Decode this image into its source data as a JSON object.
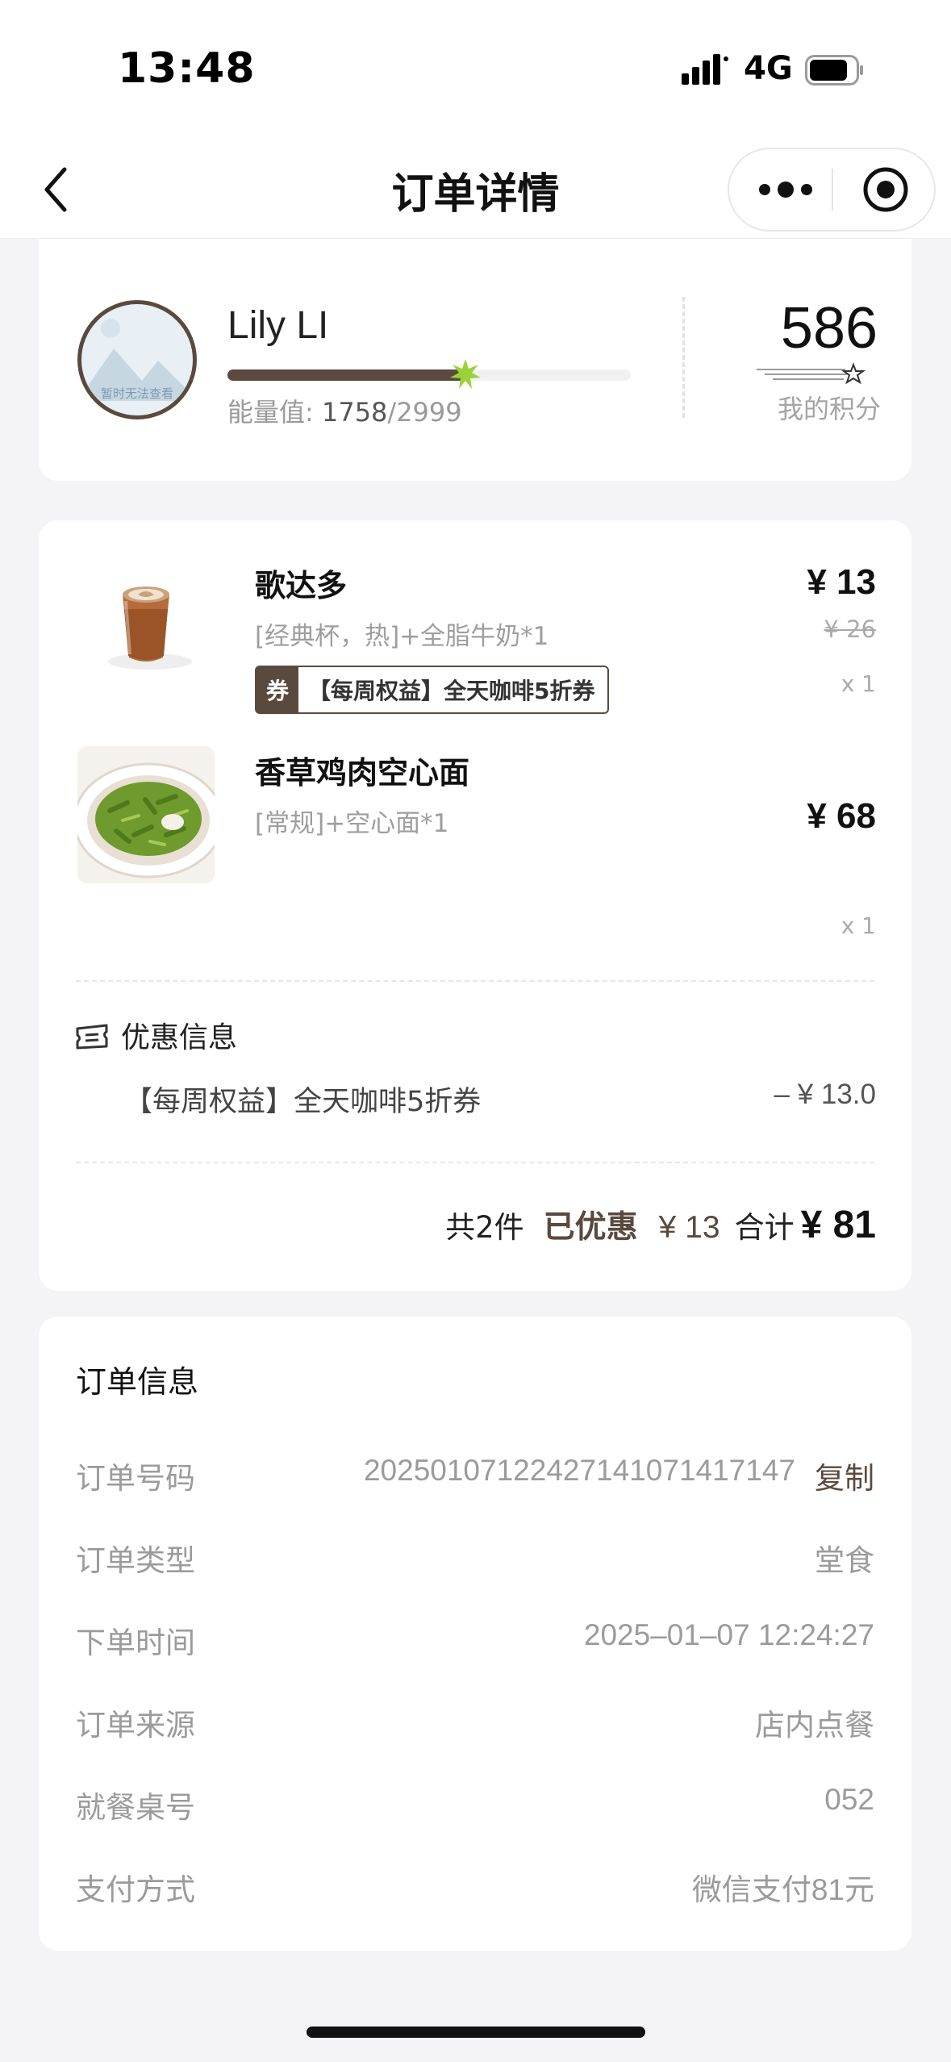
{
  "status_bar": {
    "time": "13:48",
    "network": "4G"
  },
  "nav": {
    "title": "订单详情"
  },
  "user": {
    "name": "Lily LI",
    "avatar_placeholder": "暂时无法查看",
    "energy_label": "能量值:",
    "energy_current": "1758",
    "energy_max": "/2999",
    "energy_progress": 0.59,
    "points": "586",
    "points_label": "我的积分"
  },
  "products": [
    {
      "name": "歌达多",
      "spec": "[经典杯，热]+全脂牛奶*1",
      "price": "¥ 13",
      "original_price": "¥ 26",
      "qty": "x 1",
      "coupon_tag": "券",
      "coupon_text": "【每周权益】全天咖啡5折券"
    },
    {
      "name": "香草鸡肉空心面",
      "spec": "[常规]+空心面*1",
      "price": "¥ 68",
      "qty": "x 1"
    }
  ],
  "discount": {
    "title": "优惠信息",
    "name": "【每周权益】全天咖啡5折券",
    "amount": "– ¥ 13.0"
  },
  "summary": {
    "count": "共2件",
    "discounted_label": "已优惠",
    "discounted_value": "¥ 13",
    "total_label": "合计",
    "total_value": "¥ 81"
  },
  "order_info": {
    "title": "订单信息",
    "copy_label": "复制",
    "rows": [
      {
        "label": "订单号码",
        "value": "20250107122427141071417147"
      },
      {
        "label": "订单类型",
        "value": "堂食"
      },
      {
        "label": "下单时间",
        "value": "2025–01–07 12:24:27"
      },
      {
        "label": "订单来源",
        "value": "店内点餐"
      },
      {
        "label": "就餐桌号",
        "value": "052"
      },
      {
        "label": "支付方式",
        "value": "微信支付81元"
      }
    ]
  },
  "colors": {
    "accent": "#5a4a3e",
    "star": "#9bd23a",
    "background": "#f4f4f6"
  }
}
